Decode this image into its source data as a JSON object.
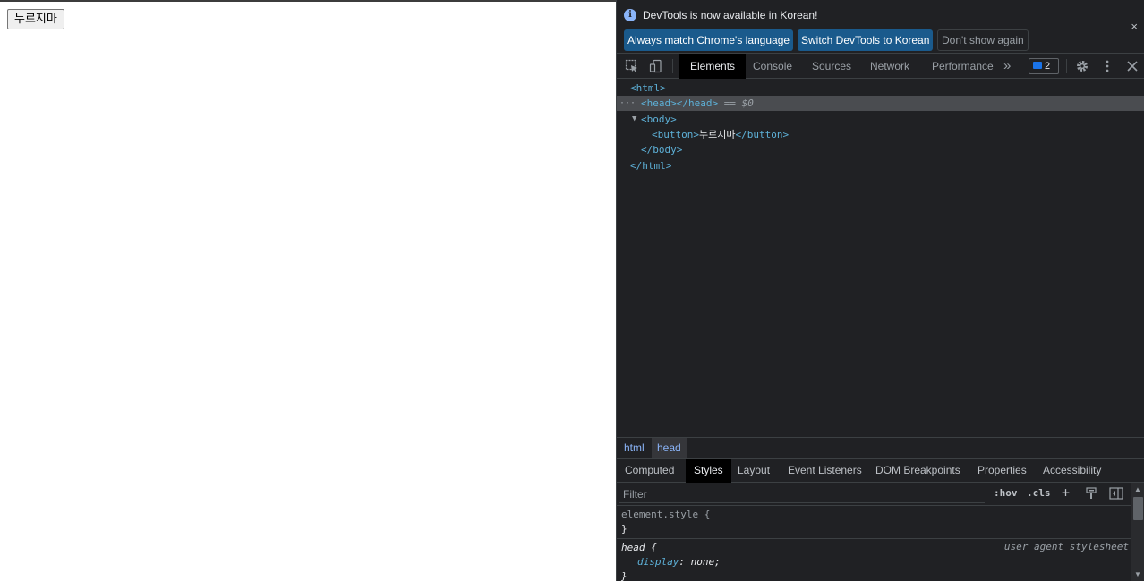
{
  "page": {
    "button_label": "누르지마"
  },
  "devtools": {
    "infobar": {
      "message": "DevTools is now available in Korean!",
      "btn_match": "Always match Chrome's language",
      "btn_switch": "Switch DevTools to Korean",
      "btn_dismiss": "Don't show again",
      "close": "×"
    },
    "tabs": [
      "Elements",
      "Console",
      "Sources",
      "Network",
      "Performance"
    ],
    "more_tabs": "»",
    "issues_count": "2",
    "elements_tree": {
      "html_open": "<html>",
      "head": "<head></head>",
      "selected_marker": "== $0",
      "body_open": "<body>",
      "button_open": "<button>",
      "button_text": "누르지마",
      "button_close": "</button>",
      "body_close": "</body>",
      "html_close": "</html>"
    },
    "breadcrumbs": [
      "html",
      "head"
    ],
    "subtabs": [
      "Computed",
      "Styles",
      "Layout",
      "Event Listeners",
      "DOM Breakpoints",
      "Properties",
      "Accessibility"
    ],
    "filter": {
      "placeholder": "Filter",
      "hov": ":hov",
      "cls": ".cls",
      "add": "+"
    },
    "styles": {
      "element_style": "element.style {",
      "close_brace": "}",
      "head_selector": "head {",
      "ua_label": "user agent stylesheet",
      "prop_name": "display",
      "prop_value": "none;"
    }
  }
}
